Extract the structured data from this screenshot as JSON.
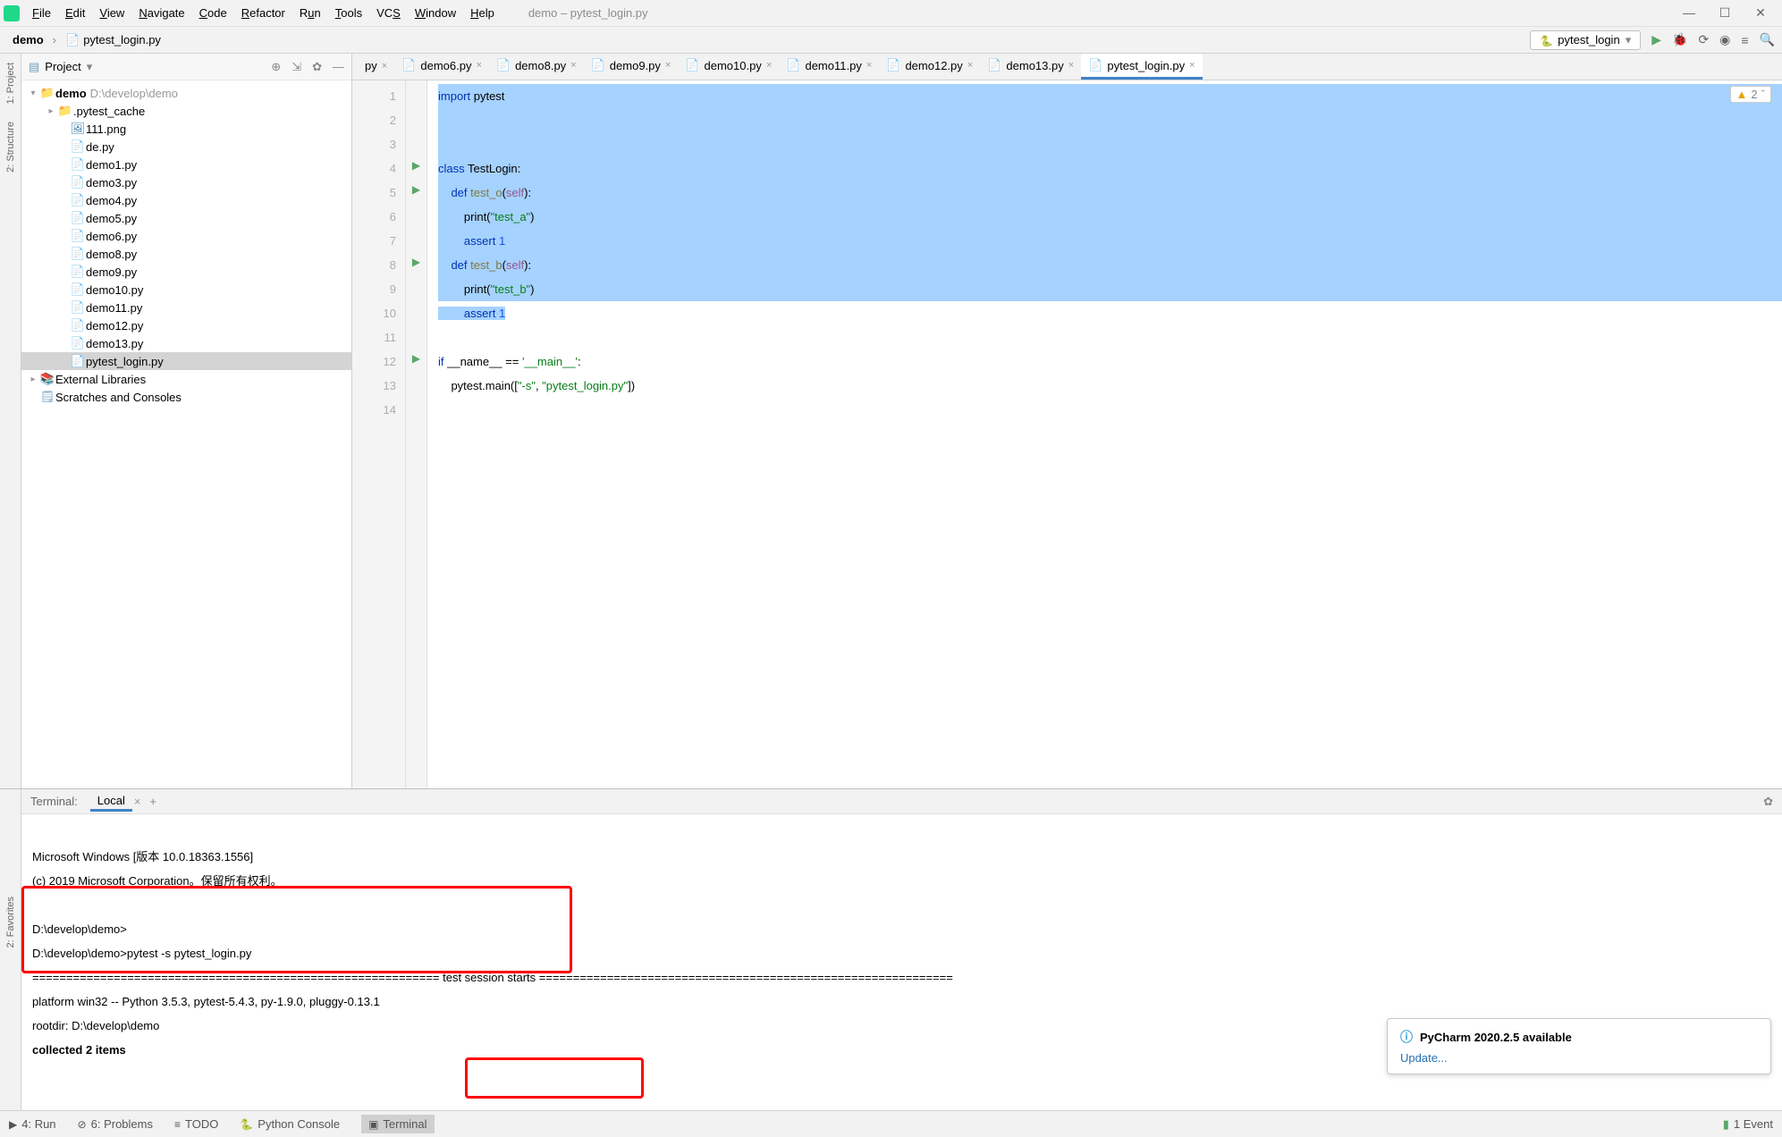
{
  "window_title": "demo – pytest_login.py",
  "menus": [
    "File",
    "Edit",
    "View",
    "Navigate",
    "Code",
    "Refactor",
    "Run",
    "Tools",
    "VCS",
    "Window",
    "Help"
  ],
  "breadcrumbs": [
    "demo",
    "pytest_login.py"
  ],
  "run_config": "pytest_login",
  "left_labels": [
    "1: Project",
    "2: Structure"
  ],
  "fav_label": "2: Favorites",
  "project_title": "Project",
  "tree": {
    "root": {
      "name": "demo",
      "path": "D:\\develop\\demo"
    },
    "cache": ".pytest_cache",
    "files": [
      "111.png",
      "de.py",
      "demo1.py",
      "demo3.py",
      "demo4.py",
      "demo5.py",
      "demo6.py",
      "demo8.py",
      "demo9.py",
      "demo10.py",
      "demo11.py",
      "demo12.py",
      "demo13.py",
      "pytest_login.py"
    ],
    "ext_lib": "External Libraries",
    "scratch": "Scratches and Consoles"
  },
  "tabs": [
    "py",
    "demo6.py",
    "demo8.py",
    "demo9.py",
    "demo10.py",
    "demo11.py",
    "demo12.py",
    "demo13.py",
    "pytest_login.py"
  ],
  "warn_count": "2",
  "code_lines": 14,
  "terminal": {
    "label": "Terminal:",
    "tab": "Local",
    "lines": [
      "Microsoft Windows [版本 10.0.18363.1556]",
      "(c) 2019 Microsoft Corporation。保留所有权利。",
      "",
      "D:\\develop\\demo>",
      "D:\\develop\\demo>pytest -s pytest_login.py",
      "============================================================ test session starts =============================================================",
      "platform win32 -- Python 3.5.3, pytest-5.4.3, py-1.9.0, pluggy-0.13.1",
      "rootdir: D:\\develop\\demo",
      "collected 2 items"
    ]
  },
  "notif": {
    "title": "PyCharm 2020.2.5 available",
    "link": "Update..."
  },
  "status": {
    "run": "4: Run",
    "problems": "6: Problems",
    "todo": "TODO",
    "pyconsole": "Python Console",
    "terminal": "Terminal",
    "event": "1 Event"
  }
}
